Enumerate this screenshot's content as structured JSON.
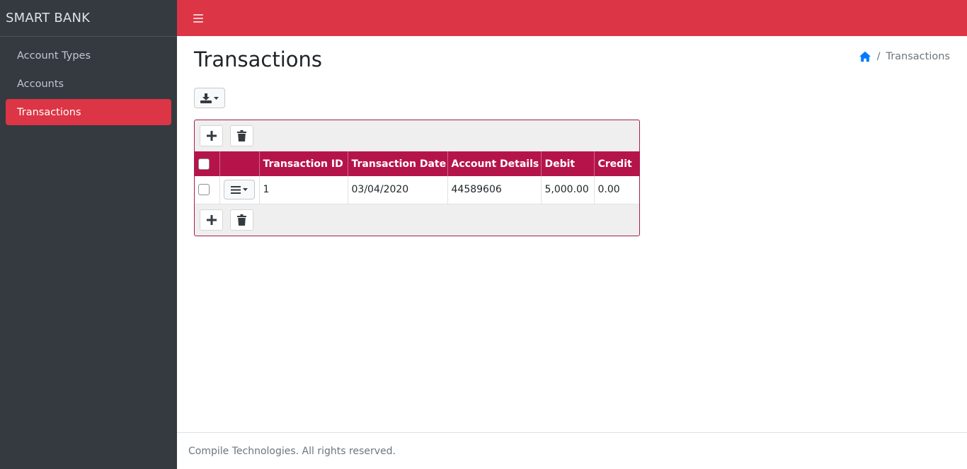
{
  "app": {
    "brand": "SMART BANK"
  },
  "sidebar": {
    "items": [
      {
        "label": "Account Types"
      },
      {
        "label": "Accounts"
      },
      {
        "label": "Transactions",
        "active": true
      }
    ]
  },
  "page": {
    "title": "Transactions",
    "breadcrumb": {
      "home_icon": "home-icon",
      "current": "Transactions"
    }
  },
  "grid": {
    "columns": [
      "Transaction ID",
      "Transaction Date",
      "Account Details",
      "Debit",
      "Credit"
    ],
    "rows": [
      {
        "transaction_id": "1",
        "transaction_date": "03/04/2020",
        "account_details": "44589606",
        "debit": "5,000.00",
        "credit": "0.00"
      }
    ]
  },
  "footer": {
    "text": "Compile Technologies. All rights reserved."
  },
  "colors": {
    "accent": "#dc3545",
    "sidebar_bg": "#343a40",
    "grid_header": "#b5144b",
    "grid_border": "#a51e4a",
    "link": "#007bff"
  }
}
